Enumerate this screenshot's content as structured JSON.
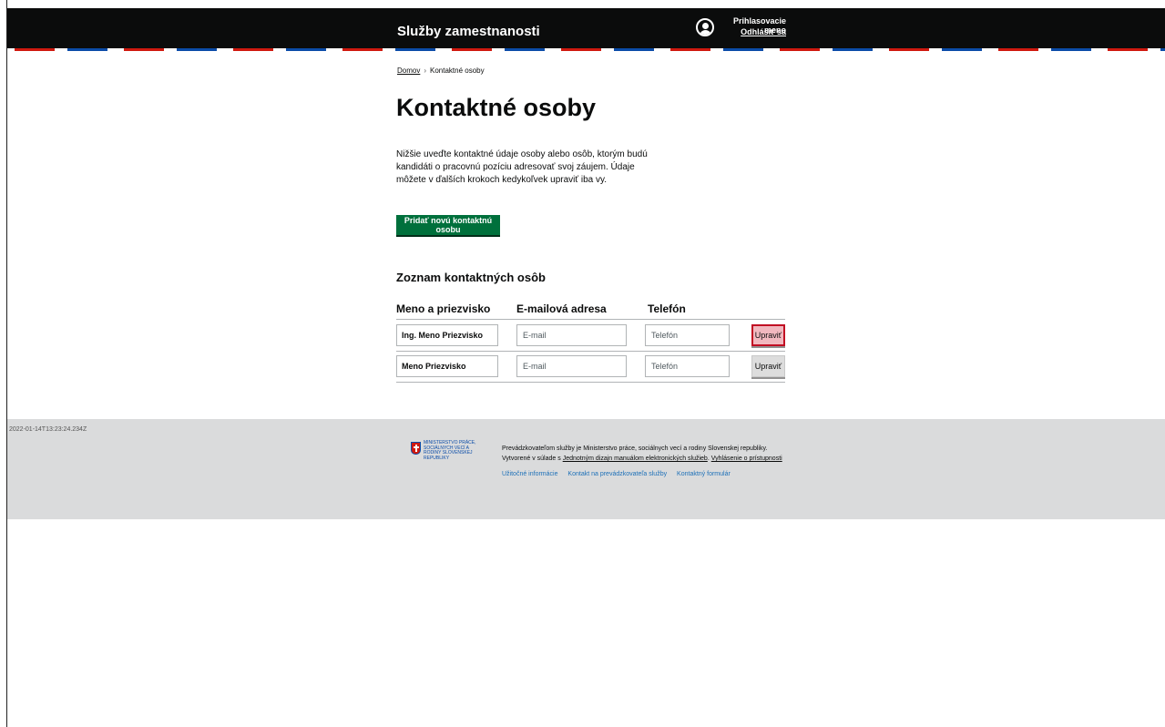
{
  "header": {
    "brand": "Služby zamestnanosti",
    "user_name": "Prihlasovacie meno",
    "logout_label": "Odhlásiť sa"
  },
  "breadcrumb": {
    "home": "Domov",
    "separator": "›",
    "current": "Kontaktné osoby"
  },
  "page": {
    "title": "Kontaktné osoby",
    "intro": "Nižšie uveďte kontaktné údaje osoby alebo osôb, ktorým budú kandidáti o pracovnú pozíciu adresovať svoj záujem. Údaje môžete v ďalších krokoch kedykoľvek upraviť iba vy.",
    "add_button": "Pridať novú kontaktnú osobu",
    "list_title": "Zoznam kontaktných osôb"
  },
  "table": {
    "columns": [
      "Meno a priezvisko",
      "E-mailová adresa",
      "Telefón"
    ],
    "rows": [
      {
        "name": "Ing. Meno Priezvisko",
        "email_placeholder": "E-mail",
        "phone_placeholder": "Telefón",
        "action": "Upraviť"
      },
      {
        "name": "Meno Priezvisko",
        "email_placeholder": "E-mail",
        "phone_placeholder": "Telefón",
        "action": "Upraviť"
      }
    ]
  },
  "footer": {
    "timestamp": "2022-01-14T13:23:24.234Z",
    "logo_text": "Ministerstvo práce, sociálnych vecí a rodiny Slovenskej republiky",
    "text_1": "Prevádzkovateľom služby je Ministerstvo práce, sociálnych vecí a rodiny Slovenskej republiky. Vytvorené v súlade s",
    "link_design": "Jednotným dizajn manuálom elektronických služieb",
    "text_2": ".",
    "link_accessibility": "Vyhlásenie o prístupnosti",
    "links": [
      "Užitočné informácie",
      "Kontakt na prevádzkovateľa služby",
      "Kontaktný formulár"
    ]
  },
  "colors": {
    "header_bg": "#0b0c0c",
    "primary_button": "#00703c",
    "focus_outline": "#c10d23",
    "footer_bg": "#dadbdc",
    "link": "#1d70b8"
  }
}
